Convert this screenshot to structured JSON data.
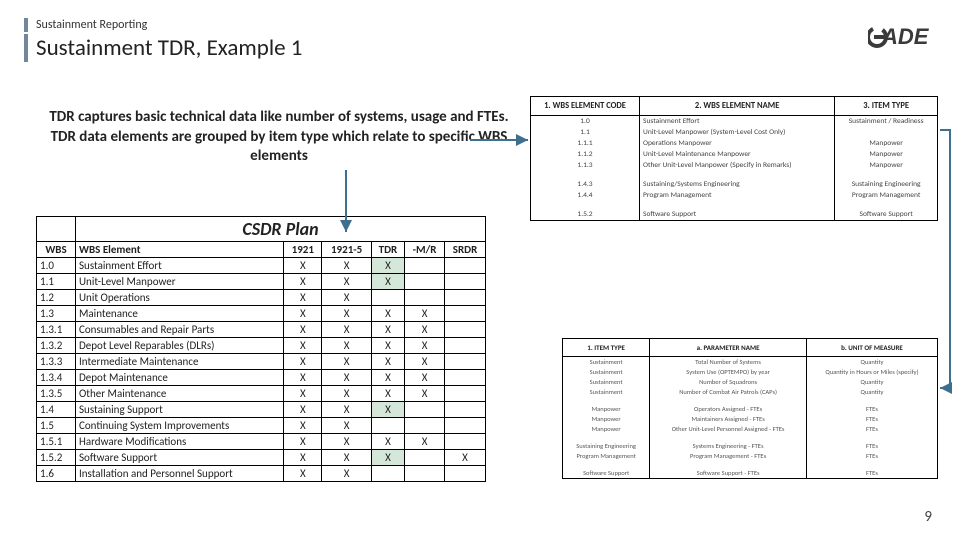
{
  "header": {
    "kicker": "Sustainment Reporting",
    "title": "Sustainment TDR, Example 1"
  },
  "intro": "TDR captures basic technical data like number of systems, usage and FTEs.  TDR data elements are grouped by item type which relate to specific WBS elements",
  "csdr": {
    "main": "CSDR Plan",
    "cols": [
      "WBS",
      "WBS Element",
      "1921",
      "1921-5",
      "TDR",
      "-M/R",
      "SRDR"
    ],
    "rows": [
      [
        "1.0",
        "Sustainment Effort",
        "X",
        "X",
        "X",
        "",
        ""
      ],
      [
        "1.1",
        "Unit-Level Manpower",
        "X",
        "X",
        "X",
        "",
        ""
      ],
      [
        "1.2",
        "Unit Operations",
        "X",
        "X",
        "",
        "",
        ""
      ],
      [
        "1.3",
        "Maintenance",
        "X",
        "X",
        "X",
        "X",
        ""
      ],
      [
        "1.3.1",
        "Consumables and Repair Parts",
        "X",
        "X",
        "X",
        "X",
        ""
      ],
      [
        "1.3.2",
        "Depot Level Reparables (DLRs)",
        "X",
        "X",
        "X",
        "X",
        ""
      ],
      [
        "1.3.3",
        "Intermediate Maintenance",
        "X",
        "X",
        "X",
        "X",
        ""
      ],
      [
        "1.3.4",
        "Depot Maintenance",
        "X",
        "X",
        "X",
        "X",
        ""
      ],
      [
        "1.3.5",
        "Other Maintenance",
        "X",
        "X",
        "X",
        "X",
        ""
      ],
      [
        "1.4",
        "Sustaining Support",
        "X",
        "X",
        "X",
        "",
        ""
      ],
      [
        "1.5",
        "Continuing System Improvements",
        "X",
        "X",
        "",
        "",
        ""
      ],
      [
        "1.5.1",
        "Hardware Modifications",
        "X",
        "X",
        "X",
        "X",
        ""
      ],
      [
        "1.5.2",
        "Software Support",
        "X",
        "X",
        "X",
        "",
        "X"
      ],
      [
        "1.6",
        "Installation and Personnel Support",
        "X",
        "X",
        "",
        "",
        ""
      ]
    ],
    "tdr_highlight": [
      0,
      1,
      9,
      12
    ]
  },
  "tbl1": {
    "cols": [
      "1. WBS ELEMENT CODE",
      "2. WBS ELEMENT NAME",
      "3. ITEM TYPE"
    ],
    "groups": [
      [
        [
          "1.0",
          "Sustainment Effort",
          "Sustainment / Readiness"
        ],
        [
          "1.1",
          "Unit-Level Manpower (System-Level Cost Only)",
          ""
        ],
        [
          "1.1.1",
          "Operations Manpower",
          "Manpower"
        ],
        [
          "1.1.2",
          "Unit-Level Maintenance Manpower",
          "Manpower"
        ],
        [
          "1.1.3",
          "Other Unit-Level Manpower (Specify in Remarks)",
          "Manpower"
        ]
      ],
      [
        [
          "1.4.3",
          "Sustaining/Systems Engineering",
          "Sustaining Engineering"
        ],
        [
          "1.4.4",
          "Program Management",
          "Program Management"
        ]
      ],
      [
        [
          "1.5.2",
          "Software Support",
          "Software Support"
        ]
      ]
    ]
  },
  "tbl2": {
    "cols": [
      "1. ITEM TYPE",
      "a. PARAMETER NAME",
      "b. UNIT OF MEASURE"
    ],
    "groups": [
      [
        [
          "Sustainment",
          "Total Number of Systems",
          "Quantity"
        ],
        [
          "Sustainment",
          "System Use (OPTEMPO) by year",
          "Quantity in Hours or Miles (specify)"
        ],
        [
          "Sustainment",
          "Number of Squadrons",
          "Quantity"
        ],
        [
          "Sustainment",
          "Number of Combat Air Patrols (CAPs)",
          "Quantity"
        ]
      ],
      [
        [
          "Manpower",
          "Operators Assigned - FTEs",
          "FTEs"
        ],
        [
          "Manpower",
          "Maintainers Assigned - FTEs",
          "FTEs"
        ],
        [
          "Manpower",
          "Other Unit-Level Personnel Assigned - FTEs",
          "FTEs"
        ]
      ],
      [
        [
          "Sustaining Engineering",
          "Systems Engineering - FTEs",
          "FTEs"
        ],
        [
          "Program Management",
          "Program Management - FTEs",
          "FTEs"
        ]
      ],
      [
        [
          "Software Support",
          "Software Support - FTEs",
          "FTEs"
        ]
      ]
    ]
  },
  "pagenum": "9"
}
